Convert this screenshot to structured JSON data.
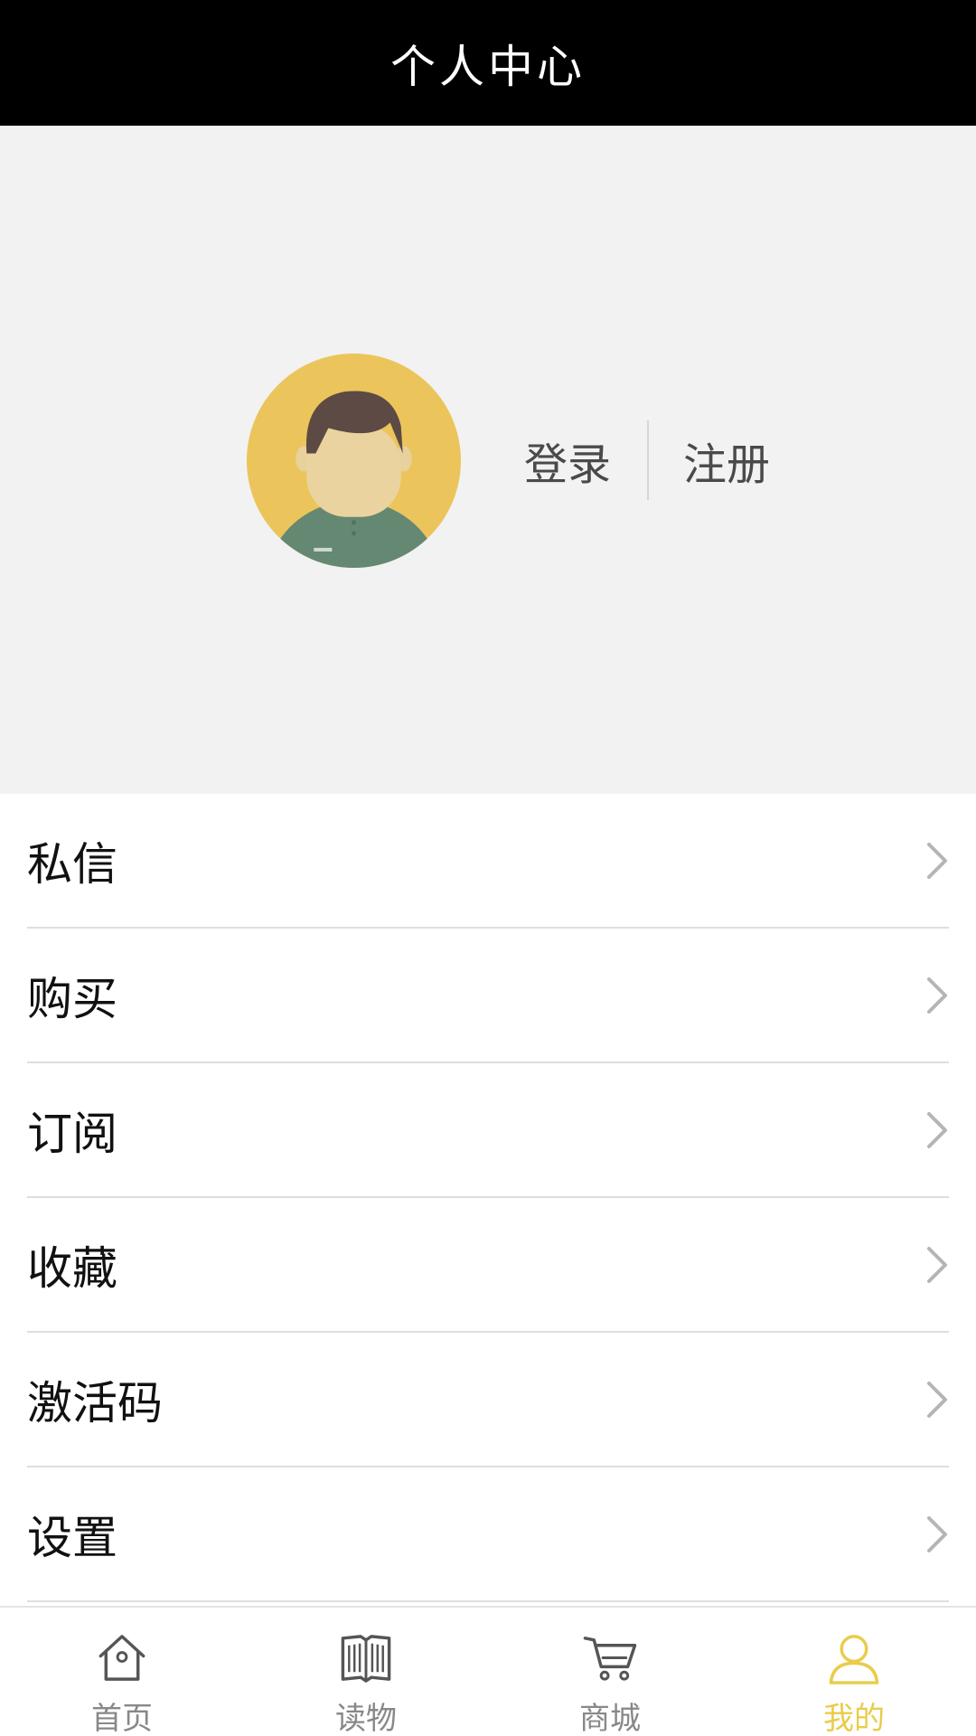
{
  "header": {
    "title": "个人中心"
  },
  "profile": {
    "login_label": "登录",
    "register_label": "注册"
  },
  "menu": {
    "items": [
      {
        "label": "私信"
      },
      {
        "label": "购买"
      },
      {
        "label": "订阅"
      },
      {
        "label": "收藏"
      },
      {
        "label": "激活码"
      },
      {
        "label": "设置"
      }
    ]
  },
  "tabbar": {
    "items": [
      {
        "label": "首页",
        "icon": "home-icon"
      },
      {
        "label": "读物",
        "icon": "book-icon"
      },
      {
        "label": "商城",
        "icon": "cart-icon"
      },
      {
        "label": "我的",
        "icon": "user-icon",
        "active": true
      }
    ]
  },
  "colors": {
    "header_bg": "#000000",
    "profile_bg": "#f2f2f2",
    "accent": "#e9cc4a",
    "avatar_bg": "#ebc55b"
  }
}
